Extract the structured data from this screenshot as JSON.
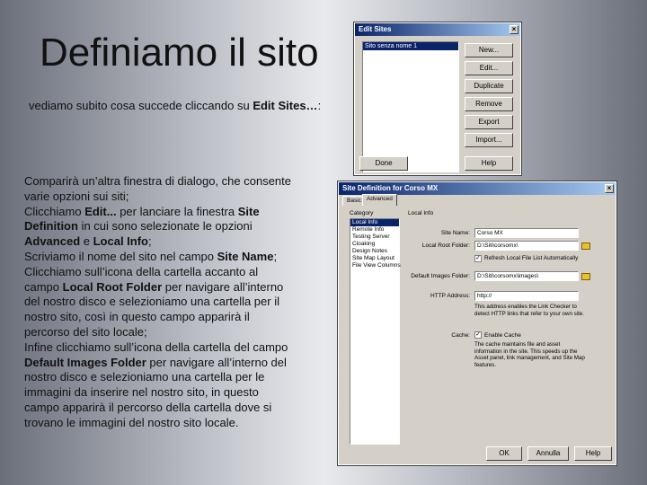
{
  "slide": {
    "title": "Definiamo il sito",
    "subtitle_prefix": "vediamo subito cosa succede cliccando su ",
    "subtitle_bold": "Edit Sites…",
    "subtitle_suffix": ":"
  },
  "body": {
    "l1": "Comparirà un’altra finestra di dialogo, che consente",
    "l2": "varie opzioni sui siti;",
    "l3a": "Clicchiamo ",
    "l3b": "Edit...",
    "l3c": " per lanciare la finestra ",
    "l3d": "Site",
    "l4a": "Definition",
    "l4b": " in cui sono selezionate le opzioni",
    "l5a": "Advanced",
    "l5b": " e ",
    "l5c": "Local Info",
    "l5d": ";",
    "l6a": "Scriviamo il nome del sito nel campo ",
    "l6b": "Site Name",
    "l6c": ";",
    "l7": "Clicchiamo sull’icona della cartella accanto al",
    "l8a": "campo ",
    "l8b": "Local Root Folder",
    "l8c": " per navigare all’interno",
    "l9": "del nostro disco e selezioniamo una cartella per il",
    "l10": "nostro sito, così in questo campo apparirà il",
    "l11": "percorso del sito locale;",
    "l12": "Infine clicchiamo sull’icona della cartella del campo",
    "l13a": "Default Images Folder",
    "l13b": " per navigare all’interno del",
    "l14": "nostro disco e selezioniamo una cartella per le",
    "l15": "immagini da inserire nel nostro sito, in questo",
    "l16": "campo apparirà il percorso della cartella dove si",
    "l17": "trovano le immagini del nostro sito locale."
  },
  "edit_sites": {
    "title": "Edit Sites",
    "list_item": "Sito senza nome 1",
    "buttons": [
      "New...",
      "Edit...",
      "Duplicate",
      "Remove",
      "Export",
      "Import..."
    ],
    "done": "Done",
    "help": "Help"
  },
  "site_def": {
    "title": "Site Definition for Corso MX",
    "tabs": [
      "Basic",
      "Advanced"
    ],
    "category_label": "Category",
    "section_label": "Local Info",
    "categories": [
      "Local Info",
      "Remote Info",
      "Testing Server",
      "Cloaking",
      "Design Notes",
      "Site Map Layout",
      "File View Columns"
    ],
    "site_name_label": "Site Name:",
    "site_name_value": "Corso MX",
    "local_root_label": "Local Root Folder:",
    "local_root_value": "D:\\Siti\\corsomx\\",
    "refresh_label": "Refresh Local File List Automatically",
    "default_images_label": "Default Images Folder:",
    "default_images_value": "D:\\Siti\\corsomx\\images\\",
    "http_label": "HTTP Address:",
    "http_value": "http://",
    "http_note": "This address enables the Link Checker to detect HTTP links that refer to your own site.",
    "cache_label": "Cache:",
    "cache_check": "Enable Cache",
    "cache_note": "The cache maintains file and asset information in the site. This speeds up the Asset panel, link management, and Site Map features.",
    "ok": "OK",
    "cancel": "Annulla",
    "help": "Help"
  },
  "colors": {
    "titlebar_start": "#0a246a",
    "titlebar_end": "#a6caf0",
    "dialog_bg": "#d4d0c8"
  }
}
